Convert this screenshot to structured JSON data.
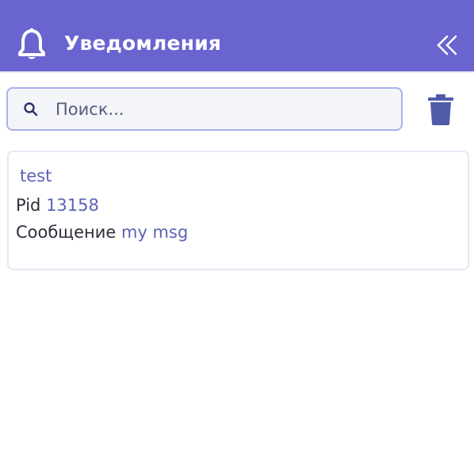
{
  "header": {
    "title": "Уведомления",
    "bell_icon": "bell-icon",
    "collapse_icon": "double-chevron-left-icon",
    "background": "#6a64d0"
  },
  "search": {
    "placeholder": "Поиск...",
    "value": "",
    "icon": "search-icon"
  },
  "toolbar": {
    "delete_icon": "trash-icon"
  },
  "notifications": [
    {
      "title": "test",
      "pid_label": "Pid",
      "pid_value": "13158",
      "message_label": "Сообщение",
      "message_value": "my msg"
    }
  ],
  "colors": {
    "accent": "#5b63b6",
    "trash": "#4f5aa8",
    "search_border": "#a7b2ee"
  }
}
